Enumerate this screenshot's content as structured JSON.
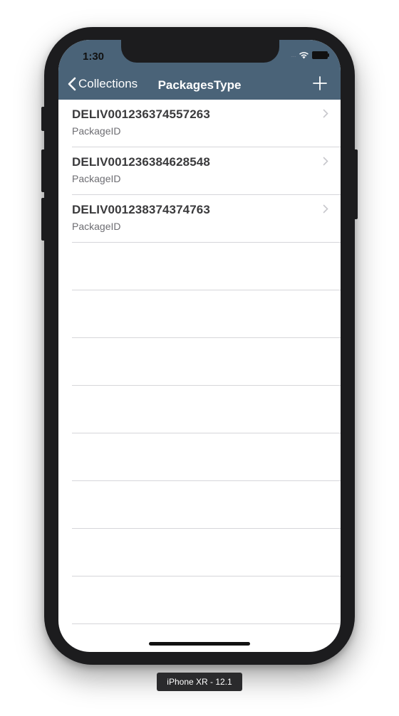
{
  "status_bar": {
    "time": "1:30",
    "signal": "....",
    "wifi_icon": "wifi-icon",
    "battery_icon": "battery-icon"
  },
  "nav": {
    "back_label": "Collections",
    "title": "PackagesType",
    "add_icon": "plus-icon"
  },
  "rows": [
    {
      "title": "DELIV001236374557263",
      "subtitle": "PackageID"
    },
    {
      "title": "DELIV001236384628548",
      "subtitle": "PackageID"
    },
    {
      "title": "DELIV001238374374763",
      "subtitle": "PackageID"
    }
  ],
  "device_label": "iPhone XR - 12.1",
  "colors": {
    "nav_bar": "#4a6378",
    "separator": "#d6d6da",
    "device_frame": "#1c1c1e"
  }
}
